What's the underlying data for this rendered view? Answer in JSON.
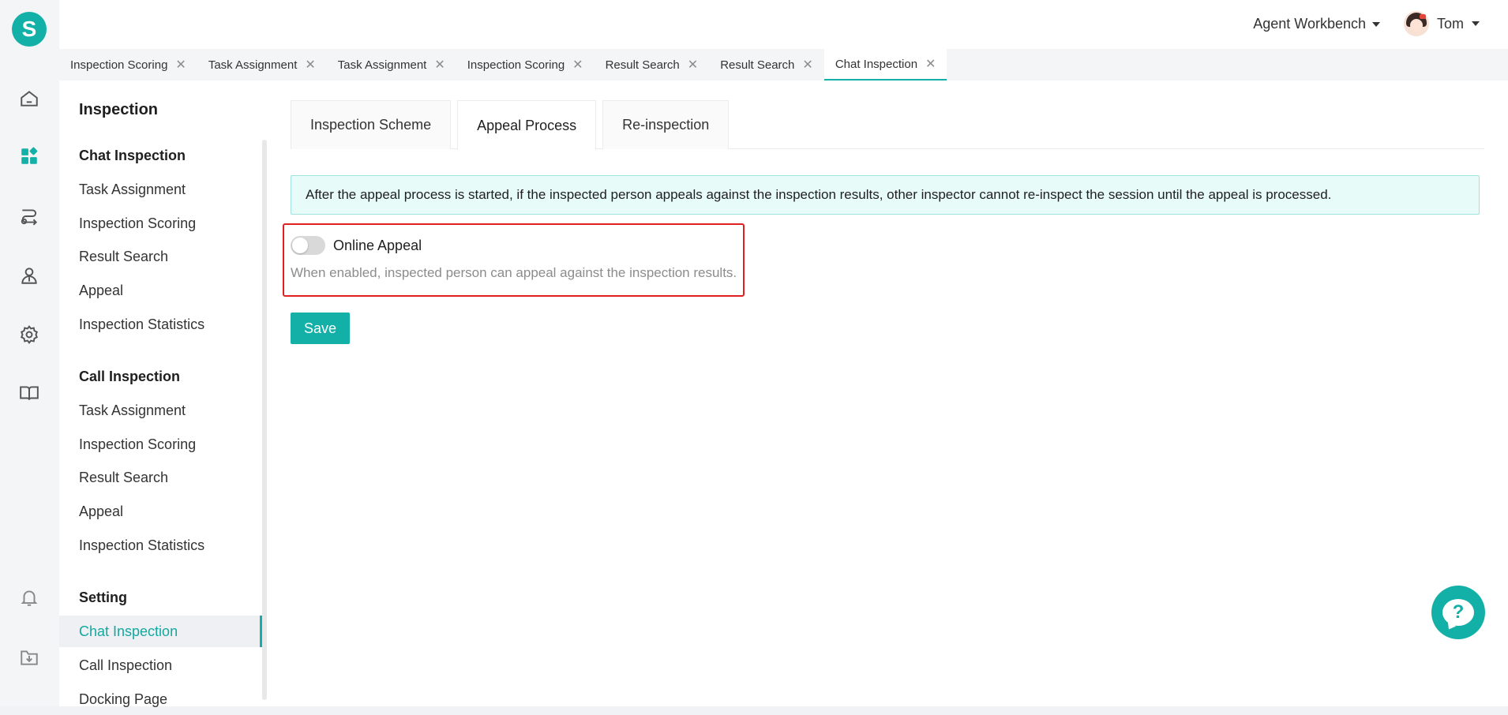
{
  "header": {
    "logo_letter": "S",
    "workbench_label": "Agent Workbench",
    "user_name": "Tom"
  },
  "rail": {
    "icons": [
      "home-icon",
      "dashboard-icon",
      "route-icon",
      "agent-icon",
      "gear-icon",
      "book-icon",
      "bell-icon",
      "download-folder-icon"
    ],
    "active_index": 1
  },
  "page_tabs": [
    {
      "label": "Inspection Scoring",
      "active": false
    },
    {
      "label": "Task Assignment",
      "active": false
    },
    {
      "label": "Task Assignment",
      "active": false
    },
    {
      "label": "Inspection Scoring",
      "active": false
    },
    {
      "label": "Result Search",
      "active": false
    },
    {
      "label": "Result Search",
      "active": false
    },
    {
      "label": "Chat Inspection",
      "active": true
    }
  ],
  "sidebar": {
    "title": "Inspection",
    "groups": [
      {
        "label": "Chat Inspection",
        "items": [
          "Task Assignment",
          "Inspection Scoring",
          "Result Search",
          "Appeal",
          "Inspection Statistics"
        ]
      },
      {
        "label": "Call Inspection",
        "items": [
          "Task Assignment",
          "Inspection Scoring",
          "Result Search",
          "Appeal",
          "Inspection Statistics"
        ]
      },
      {
        "label": "Setting",
        "items": [
          "Chat Inspection",
          "Call Inspection",
          "Docking Page"
        ]
      }
    ],
    "active_item": "Setting/Chat Inspection"
  },
  "content_tabs": [
    {
      "label": "Inspection Scheme",
      "active": false
    },
    {
      "label": "Appeal Process",
      "active": true
    },
    {
      "label": "Re-inspection",
      "active": false
    }
  ],
  "notice": "After the appeal process is started, if the inspected person appeals against the inspection results, other inspector cannot re-inspect the session until the appeal is processed.",
  "online_appeal": {
    "label": "Online Appeal",
    "enabled": false,
    "description": "When enabled, inspected person can appeal against the inspection results."
  },
  "save_label": "Save",
  "help_label": "?",
  "colors": {
    "accent": "#13b0a8",
    "highlight": "#e02020"
  }
}
